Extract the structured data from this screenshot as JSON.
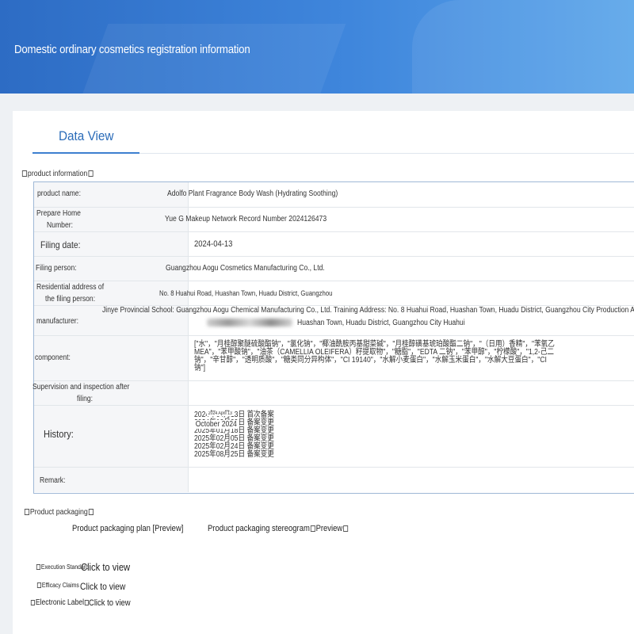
{
  "banner": {
    "title": "Domestic ordinary cosmetics registration information"
  },
  "tabs": {
    "data_view": "Data View"
  },
  "sections": {
    "product_information": "product information",
    "product_packaging": "Product packaging"
  },
  "rows": {
    "product_name": {
      "label": "product name:",
      "value": "Adolfo Plant Fragrance Body Wash (Hydrating Soothing)"
    },
    "record_number": {
      "label1": "Prepare Home",
      "label2": "Number:",
      "value": "Yue G Makeup Network Record Number 2024126473"
    },
    "filing_date": {
      "label": "Filing date:",
      "value": "2024-04-13"
    },
    "filing_person": {
      "label": "Filing person:",
      "value": "Guangzhou Aogu Cosmetics Manufacturing Co., Ltd."
    },
    "residential_address": {
      "label1": "Residential address of",
      "label2": "the filing person:",
      "value": "No. 8 Huahui Road, Huashan Town, Huadu District, Guangzhou"
    },
    "manufacturer": {
      "label": "manufacturer:",
      "value_line1": "Jinye Provincial School: Guangzhou Aogu Chemical Manufacturing Co., Ltd. Training Address: No. 8 Huahui Road, Huashan Town, Huadu District, Guangzhou City Production Ad",
      "value_line2": "Huashan Town, Huadu District, Guangzhou City Huahui"
    },
    "component": {
      "label": "component:",
      "line1": "[\"水\"，\"月桂醇聚醚硫酸酯钠\"，\"氯化钠\"，\"椰油酰胺丙基甜菜碱\"，\"月桂醇磺基琥珀酸酯二钠\"，\"（日用）香精\"，\"苯氧乙",
      "line2": "MEA\"，\"苯甲酸钠\"，\"油茶（CAMELLIA OLEIFERA）籽提取物\"，\"糖脂\"，\"EDTA 二钠\"，\"苯甲醇\"，\"柠檬酸\"，\"1,2-己二",
      "line3": "钠\"，\"辛甘醇\"，\"透明质酸\"，\"糖类同分异构体\"，\"CI 19140\"，\"水解小麦蛋白\"，\"水解玉米蛋白\"，\"水解大豆蛋白\"，\"CI",
      "line4": "钠\"]"
    },
    "supervision": {
      "label1": "Supervision and inspection after",
      "label2": "filing:",
      "value": ""
    },
    "history": {
      "label": "History:",
      "overlay_small": "2024 April 13",
      "overlay_large": "October 2024",
      "entries": [
        "2024年04月13日 首次备案",
        "2024年10月09日 备案变更",
        "2025年01月18日 备案变更",
        "2025年02月05日 备案变更",
        "2025年02月24日 备案变更",
        "2025年08月25日 备案变更"
      ]
    },
    "remark": {
      "label": "Remark:",
      "value": ""
    }
  },
  "packaging": {
    "plan": "Product packaging plan [Preview]",
    "stereogram": "Product packaging stereogram",
    "stereogram_preview": "Preview"
  },
  "links": {
    "execution_standard": "Execution Standard",
    "efficacy_claims": "Efficacy Claims",
    "electronic_label": "Electronic Label",
    "click_to_view": "Click to view"
  }
}
